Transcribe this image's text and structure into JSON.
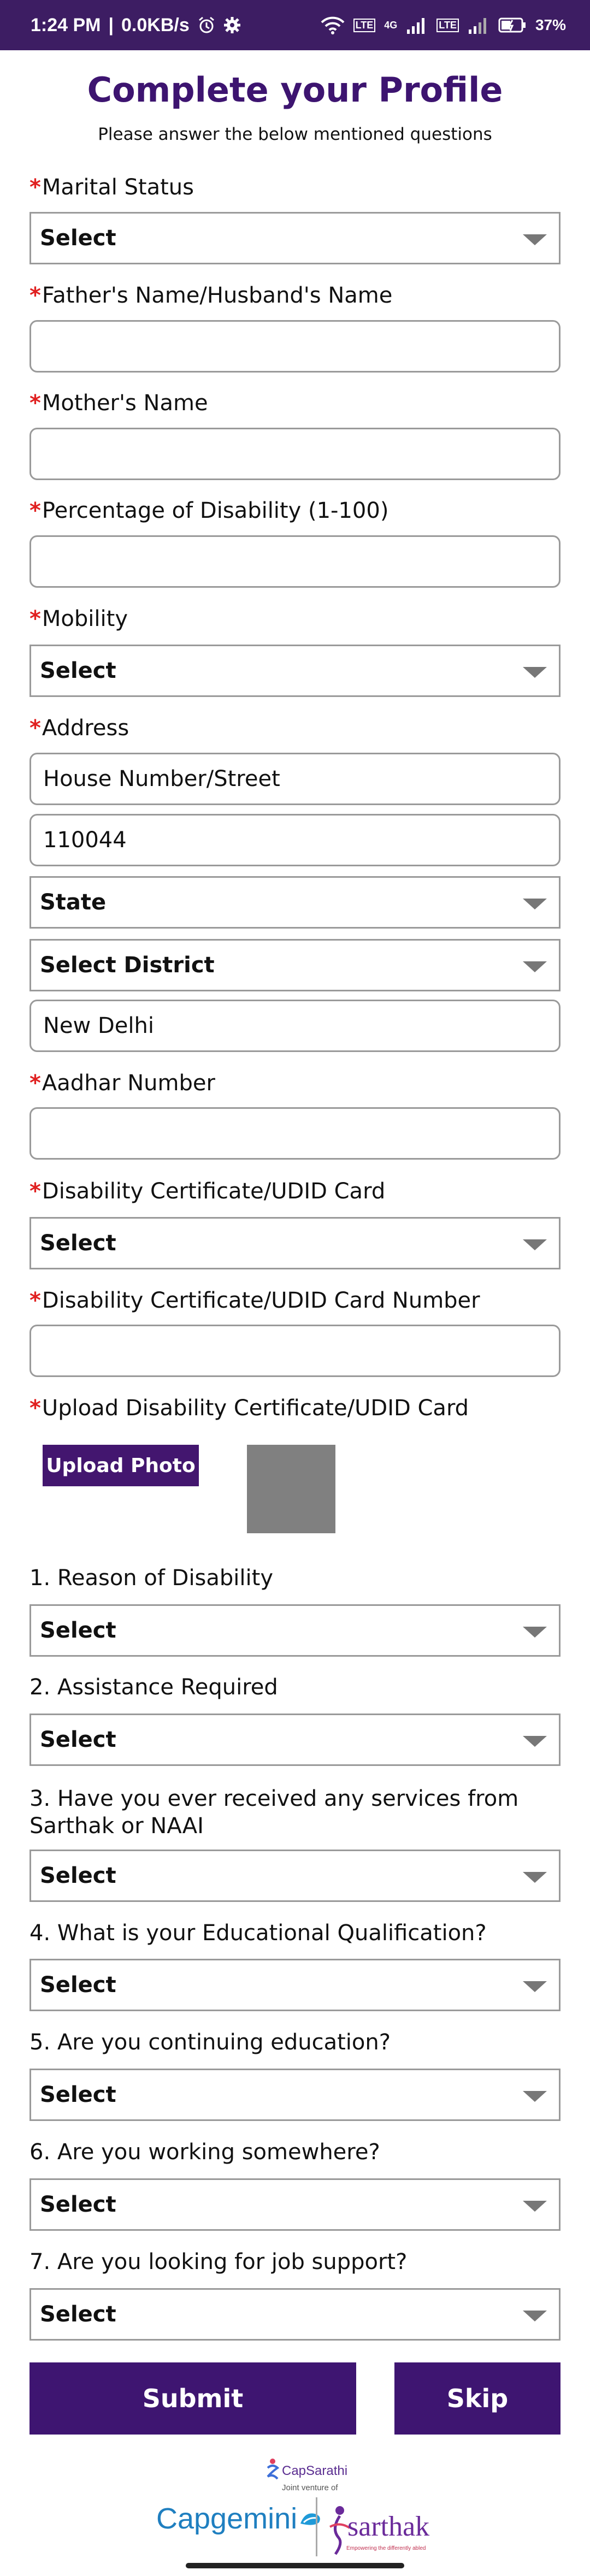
{
  "status_bar": {
    "time": "1:24 PM",
    "network_speed": "0.0KB/s",
    "battery": "37%",
    "lte1": "LTE",
    "lte2": "LTE",
    "net_4g": "4G",
    "icons": [
      "alarm-icon",
      "gear-icon",
      "wifi-icon",
      "signal-icon",
      "signal-icon",
      "battery-icon"
    ]
  },
  "page": {
    "title": "Complete your Profile",
    "subtitle": "Please answer the below mentioned questions"
  },
  "form": {
    "marital_status": {
      "label": "Marital Status",
      "value": "Select"
    },
    "father_name": {
      "label": "Father's Name/Husband's Name",
      "value": ""
    },
    "mother_name": {
      "label": "Mother's Name",
      "value": ""
    },
    "disability_percentage": {
      "label": "Percentage of Disability (1-100)",
      "value": ""
    },
    "mobility": {
      "label": "Mobility",
      "value": "Select"
    },
    "address": {
      "label": "Address",
      "street": "House Number/Street",
      "pincode": "110044",
      "state": "State",
      "district": "Select District",
      "city": "New Delhi"
    },
    "aadhar": {
      "label": "Aadhar Number",
      "value": ""
    },
    "certificate_type": {
      "label": "Disability Certificate/UDID Card",
      "value": "Select"
    },
    "certificate_number": {
      "label": "Disability Certificate/UDID Card Number",
      "value": ""
    },
    "certificate_upload": {
      "label": "Upload Disability Certificate/UDID Card",
      "button": "Upload Photo"
    }
  },
  "questions": [
    {
      "label": "1. Reason of Disability",
      "value": "Select"
    },
    {
      "label": "2. Assistance Required",
      "value": "Select"
    },
    {
      "label_line1": "3. Have you ever received any services from",
      "label_line2": "Sarthak or NAAI",
      "value": "Select"
    },
    {
      "label": "4. What is your Educational Qualification?",
      "value": "Select"
    },
    {
      "label": "5. Are you continuing education?",
      "value": "Select"
    },
    {
      "label": "6. Are you working somewhere?",
      "value": "Select"
    },
    {
      "label": "7. Are you looking for job support?",
      "value": "Select"
    }
  ],
  "actions": {
    "submit": "Submit",
    "skip": "Skip"
  },
  "footer": {
    "capsarathi": "CapSarathi",
    "joint_venture": "Joint venture of",
    "capgemini": "Capgemini",
    "sarthak": "sarthak",
    "sarthak_tagline": "Empowering the differently abled"
  },
  "colors": {
    "brand": "#3d1470",
    "required": "#e02020",
    "status_bar": "#3d1d63"
  }
}
